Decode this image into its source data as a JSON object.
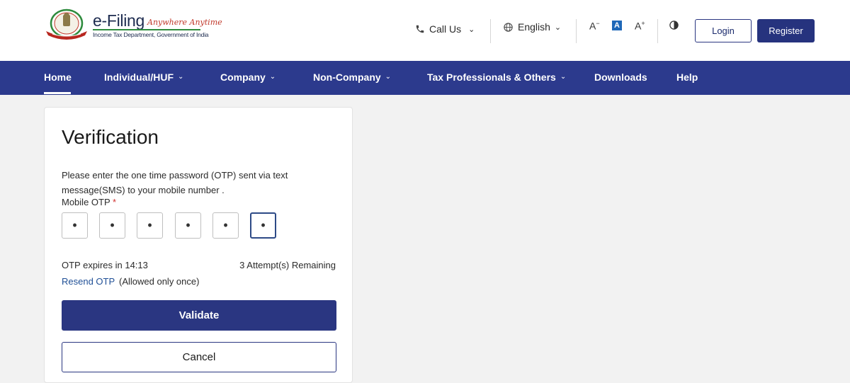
{
  "brand": {
    "name": "e-Filing",
    "tagline": "Anywhere Anytime",
    "subtitle": "Income Tax Department, Government of India"
  },
  "header": {
    "call_us": "Call Us",
    "language": "English",
    "font_decrease": "A",
    "font_default": "A",
    "font_increase": "A",
    "login": "Login",
    "register": "Register"
  },
  "nav": {
    "items": [
      {
        "label": "Home",
        "active": true
      },
      {
        "label": "Individual/HUF",
        "dropdown": true
      },
      {
        "label": "Company",
        "dropdown": true
      },
      {
        "label": "Non-Company",
        "dropdown": true
      },
      {
        "label": "Tax Professionals & Others",
        "dropdown": true
      },
      {
        "label": "Downloads"
      },
      {
        "label": "Help"
      }
    ]
  },
  "verification": {
    "title": "Verification",
    "description": "Please enter the one time password (OTP) sent via text message(SMS) to your mobile number .",
    "otp_label": "Mobile OTP",
    "required_mark": "*",
    "otp_digits": [
      "•",
      "•",
      "•",
      "•",
      "•",
      "•"
    ],
    "expiry": "OTP expires in 14:13",
    "attempts": "3 Attempt(s) Remaining",
    "resend": "Resend OTP",
    "resend_note": "(Allowed only once)",
    "validate": "Validate",
    "cancel": "Cancel"
  },
  "colors": {
    "primary": "#2a3681",
    "nav_bg": "#2c3a8d",
    "link": "#1f4f96",
    "required": "#d0302f",
    "tagline": "#c0392b"
  },
  "icons": {
    "logo": "national-emblem-logo",
    "call": "phone-icon",
    "language": "globe-icon",
    "dropdown": "chevron-down-icon",
    "contrast": "contrast-icon"
  }
}
